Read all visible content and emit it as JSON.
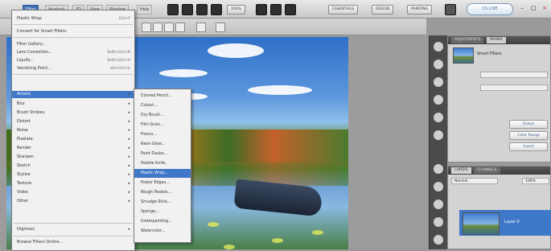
{
  "menubar": {
    "items": [
      {
        "label": "Filter",
        "active": true
      },
      {
        "label": "Analysis"
      },
      {
        "label": "3D"
      },
      {
        "label": "View"
      },
      {
        "label": "Window"
      },
      {
        "label": "Help"
      }
    ],
    "zoom": "100%",
    "workspaces": [
      "ESSENTIALS",
      "DESIGN",
      "PAINTING"
    ],
    "cs_live": "CS LIVE"
  },
  "filter_menu": {
    "items": [
      {
        "label": "Plastic Wrap",
        "key": "Ctrl+F"
      },
      {
        "label": "Convert for Smart Filters"
      },
      {
        "label": "Filter Gallery..."
      },
      {
        "label": "Lens Correction...",
        "key": "Shift+Ctrl+R"
      },
      {
        "label": "Liquify...",
        "key": "Shift+Ctrl+X"
      },
      {
        "label": "Vanishing Point...",
        "key": "Alt+Ctrl+V"
      },
      {
        "label": "Artistic",
        "highlighted": true,
        "submenu": true
      },
      {
        "label": "Blur",
        "submenu": true
      },
      {
        "label": "Brush Strokes",
        "submenu": true
      },
      {
        "label": "Distort",
        "submenu": true
      },
      {
        "label": "Noise",
        "submenu": true
      },
      {
        "label": "Pixelate",
        "submenu": true
      },
      {
        "label": "Render",
        "submenu": true
      },
      {
        "label": "Sharpen",
        "submenu": true
      },
      {
        "label": "Sketch",
        "submenu": true
      },
      {
        "label": "Stylize",
        "submenu": true
      },
      {
        "label": "Texture",
        "submenu": true
      },
      {
        "label": "Video",
        "submenu": true
      },
      {
        "label": "Other",
        "submenu": true
      },
      {
        "label": "Digimarc",
        "submenu": true
      },
      {
        "label": "Browse Filters Online..."
      }
    ]
  },
  "artistic_submenu": {
    "items": [
      {
        "label": "Colored Pencil..."
      },
      {
        "label": "Cutout..."
      },
      {
        "label": "Dry Brush..."
      },
      {
        "label": "Film Grain..."
      },
      {
        "label": "Fresco..."
      },
      {
        "label": "Neon Glow..."
      },
      {
        "label": "Paint Daubs..."
      },
      {
        "label": "Palette Knife..."
      },
      {
        "label": "Plastic Wrap...",
        "highlighted": true
      },
      {
        "label": "Poster Edges..."
      },
      {
        "label": "Rough Pastels..."
      },
      {
        "label": "Smudge Stick..."
      },
      {
        "label": "Sponge..."
      },
      {
        "label": "Underpainting..."
      },
      {
        "label": "Watercolor..."
      }
    ]
  },
  "right_panel": {
    "tabs": [
      "ADJUSTMENTS",
      "MASKS"
    ],
    "smart_filter_label": "Smart Filters",
    "buttons": [
      "Select",
      "Color Range",
      "Invert"
    ],
    "layers_tabs": [
      "LAYERS",
      "CHANNELS"
    ],
    "blend_mode": "Normal",
    "opacity": "100%",
    "layer_name": "Layer 0"
  },
  "colors": {
    "accent": "#3f78c8",
    "menubar": "#d9d9d9",
    "panel": "#d3d3d3"
  }
}
